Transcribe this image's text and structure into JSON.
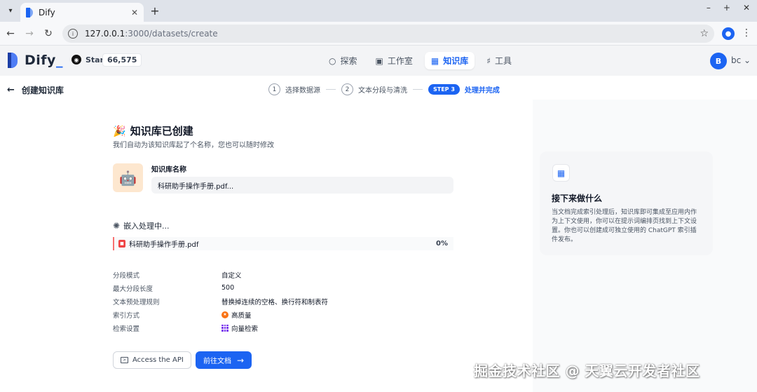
{
  "browser": {
    "tab_title": "Dify",
    "url_host": "127.0.0.1",
    "url_rest": ":3000/datasets/create"
  },
  "header": {
    "logo_text": "Dify",
    "github_label": "Star",
    "github_count": "66,575",
    "nav": [
      {
        "label": "探索",
        "icon": "compass-icon"
      },
      {
        "label": "工作室",
        "icon": "robot-icon"
      },
      {
        "label": "知识库",
        "icon": "book-icon",
        "active": true
      },
      {
        "label": "工具",
        "icon": "hammer-icon"
      }
    ],
    "avatar_letter": "B",
    "username": "bc"
  },
  "page": {
    "back_label": "创建知识库",
    "steps": [
      {
        "num": "1",
        "label": "选择数据源"
      },
      {
        "num": "2",
        "label": "文本分段与清洗"
      },
      {
        "pill": "STEP 3",
        "label": "处理并完成"
      }
    ],
    "created_title": "知识库已创建",
    "created_subtitle": "我们自动为该知识库起了个名称，您也可以随时修改",
    "kb_name_label": "知识库名称",
    "kb_name_value": "科研助手操作手册.pdf...",
    "embed_status": "嵌入处理中...",
    "file_name": "科研助手操作手册.pdf",
    "file_progress": "0%",
    "settings": [
      {
        "key": "分段模式",
        "value": "自定义"
      },
      {
        "key": "最大分段长度",
        "value": "500"
      },
      {
        "key": "文本预处理规则",
        "value": "替换掉连续的空格、换行符和制表符"
      },
      {
        "key": "索引方式",
        "value": "高质量"
      },
      {
        "key": "检索设置",
        "value": "向量检索"
      }
    ],
    "api_button": "Access the API",
    "docs_button": "前往文档"
  },
  "next_card": {
    "title": "接下来做什么",
    "body": "当文档完成索引处理后，知识库即可集成至应用内作为上下文使用，你可以在提示词编排页找到上下文设置。你也可以创建成可独立使用的 ChatGPT 索引插件发布。"
  },
  "watermark": "掘金技术社区 @ 天翼云开发者社区",
  "colors": {
    "accent": "#1c64f2",
    "header_bg": "#f3f4f6"
  }
}
